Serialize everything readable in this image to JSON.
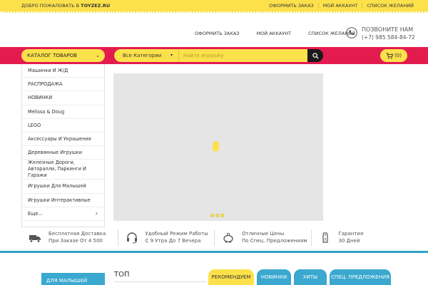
{
  "topbar": {
    "welcome_text": "Добро пожаловать в",
    "site_name": "TOYZEZ.RU",
    "links": [
      "Оформить заказ",
      "Мой аккаунт",
      "Список желаний"
    ]
  },
  "header": {
    "links": [
      "Оформить заказ",
      "Мой аккаунт",
      "Список желаний"
    ],
    "phone_title": "Позвоните нам",
    "phone_number": "(+7) 985 584-84-72"
  },
  "navbar": {
    "catalog_label": "Каталог товаров",
    "category_select": "Все Категории",
    "search_placeholder": "Найти игрушку",
    "cart_count": "(0)"
  },
  "menu": {
    "items": [
      "Машинки И Ж/Д",
      "РАСПРОДАЖА",
      "НОВИНКИ",
      "Melissa & Doug",
      "LEGO",
      "Аксессуары И Украшения",
      "Деревянные Игрушки",
      "Железные Дороги, Авторалли, Паркинги И Гаражи",
      "Игрушки Для Малышей",
      "Игрушки Интерактивные",
      "Еще..."
    ]
  },
  "features": [
    {
      "line1": "Бесплатная Доставка",
      "line2": "При Заказе От 4 500",
      "icon": "truck-icon"
    },
    {
      "line1": "Удобный Режим Работы",
      "line2": "С 9 Утра До 7 Вечера",
      "icon": "headset-icon"
    },
    {
      "line1": "Отличные Цены",
      "line2": "По Спец. Предложениям",
      "icon": "piggy-bank-icon"
    },
    {
      "line1": "Гарантия",
      "line2": "30 Дней",
      "icon": "price-tag-icon"
    }
  ],
  "bottom": {
    "sidebar_heading": "Для малышей",
    "section_title": "ТОП",
    "tabs": [
      "Рекомендуем",
      "Новинки",
      "Хиты",
      "Спец. предложения"
    ]
  },
  "colors": {
    "yellow": "#fde14b",
    "red": "#e31b4f",
    "teal": "#3aa8cf",
    "dark": "#1a1a1a"
  }
}
